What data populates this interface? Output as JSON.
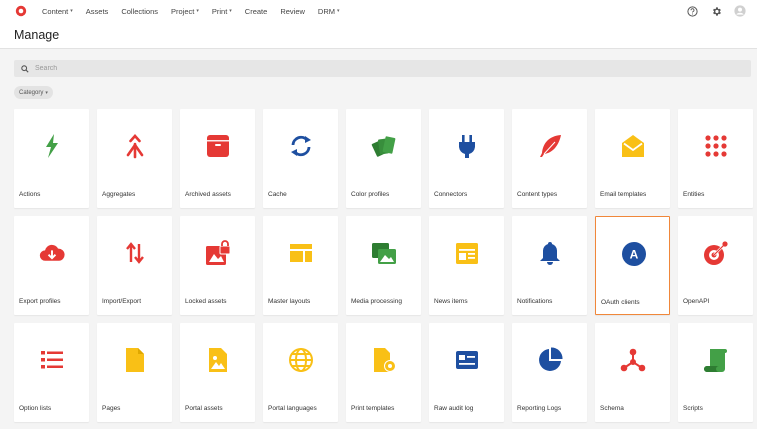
{
  "topnav": {
    "items": [
      {
        "label": "Content",
        "dropdown": true
      },
      {
        "label": "Assets",
        "dropdown": false
      },
      {
        "label": "Collections",
        "dropdown": false
      },
      {
        "label": "Project",
        "dropdown": true
      },
      {
        "label": "Print",
        "dropdown": true
      },
      {
        "label": "Create",
        "dropdown": false
      },
      {
        "label": "Review",
        "dropdown": false
      },
      {
        "label": "DRM",
        "dropdown": true
      }
    ],
    "caret": "▾"
  },
  "header": {
    "title": "Manage"
  },
  "search": {
    "placeholder": "Search"
  },
  "filter": {
    "category_label": "Category",
    "caret": "▾"
  },
  "colors": {
    "brand": "#e53935",
    "accent": "#f0873a",
    "green": "#43a047",
    "red": "#e53935",
    "blue": "#1e4fa0",
    "yellow": "#f9c016"
  },
  "tiles": [
    {
      "label": "Actions",
      "icon": "bolt-icon"
    },
    {
      "label": "Aggregates",
      "icon": "merge-icon"
    },
    {
      "label": "Archived assets",
      "icon": "archive-icon"
    },
    {
      "label": "Cache",
      "icon": "sync-icon"
    },
    {
      "label": "Color profiles",
      "icon": "swatches-icon"
    },
    {
      "label": "Connectors",
      "icon": "plug-icon"
    },
    {
      "label": "Content types",
      "icon": "feather-icon"
    },
    {
      "label": "Email templates",
      "icon": "envelope-open-icon"
    },
    {
      "label": "Entities",
      "icon": "grid-dots-icon"
    },
    {
      "label": "Export profiles",
      "icon": "cloud-download-icon"
    },
    {
      "label": "Import/Export",
      "icon": "arrows-updown-icon"
    },
    {
      "label": "Locked assets",
      "icon": "image-lock-icon"
    },
    {
      "label": "Master layouts",
      "icon": "layout-icon"
    },
    {
      "label": "Media processing",
      "icon": "images-icon"
    },
    {
      "label": "News items",
      "icon": "newspaper-icon"
    },
    {
      "label": "Notifications",
      "icon": "bell-icon"
    },
    {
      "label": "OAuth clients",
      "icon": "oauth-icon",
      "selected": true
    },
    {
      "label": "OpenAPI",
      "icon": "target-icon"
    },
    {
      "label": "Option lists",
      "icon": "list-icon"
    },
    {
      "label": "Pages",
      "icon": "page-icon"
    },
    {
      "label": "Portal assets",
      "icon": "image-file-icon"
    },
    {
      "label": "Portal languages",
      "icon": "globe-icon"
    },
    {
      "label": "Print templates",
      "icon": "file-gear-icon"
    },
    {
      "label": "Raw audit log",
      "icon": "id-card-icon"
    },
    {
      "label": "Reporting Logs",
      "icon": "pie-chart-icon"
    },
    {
      "label": "Schema",
      "icon": "network-icon"
    },
    {
      "label": "Scripts",
      "icon": "scroll-icon"
    }
  ]
}
